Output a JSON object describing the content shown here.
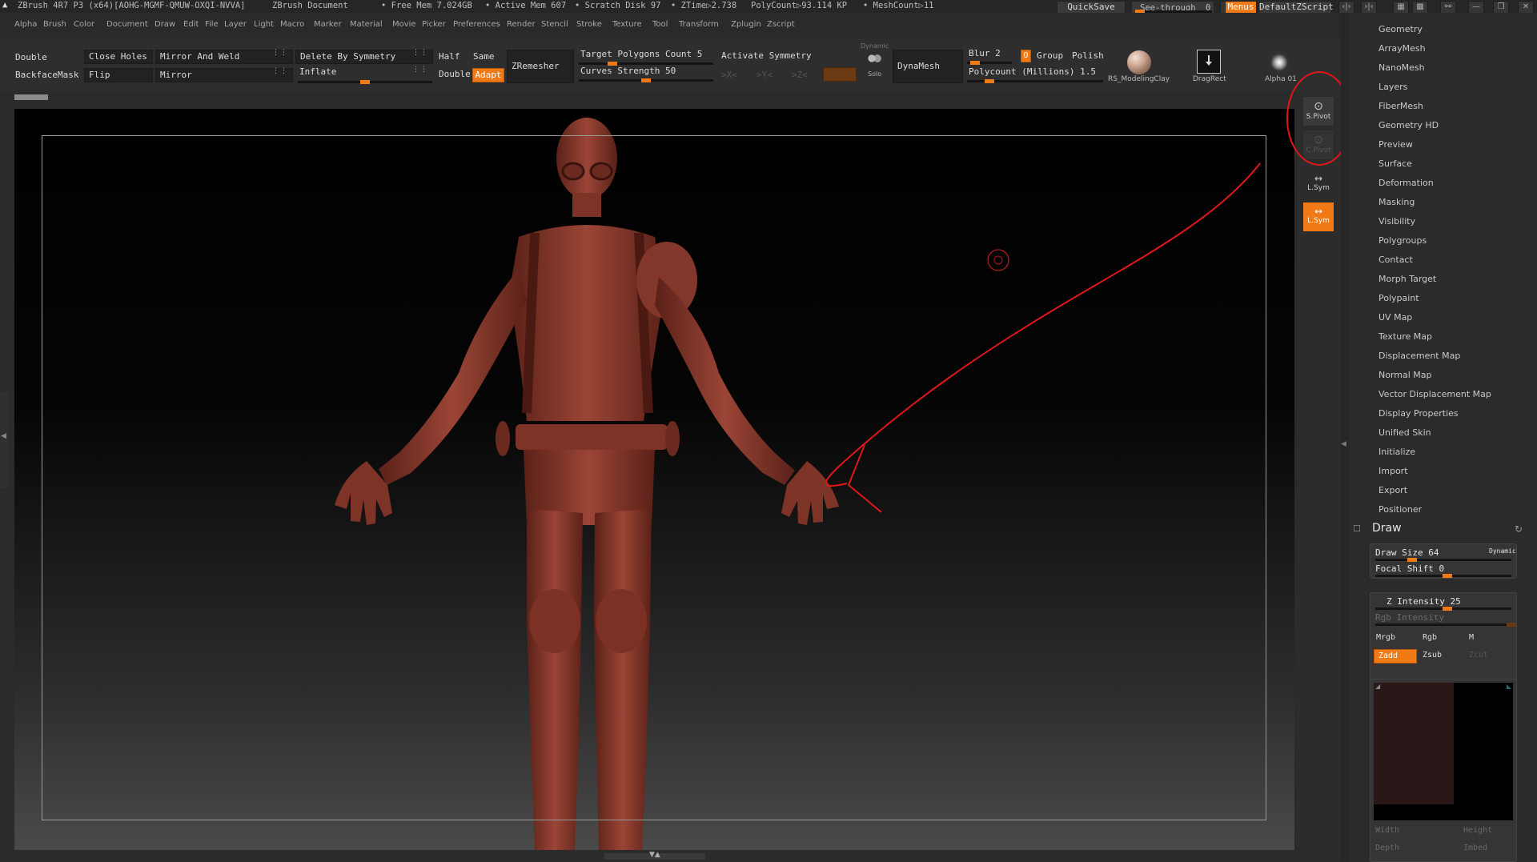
{
  "title_bar": {
    "app_title": "ZBrush 4R7 P3 (x64)[AOHG-MGMF-QMUW-OXQI-NVVA]",
    "document": "ZBrush Document",
    "free_mem": "• Free Mem 7.024GB",
    "active_mem": "• Active Mem 607",
    "scratch_disk": "• Scratch Disk 97",
    "ztime": "• ZTime▷2.738",
    "polycount": "PolyCount▷93.114 KP",
    "meshcount": "• MeshCount▷11",
    "quicksave": "QuickSave",
    "see_through_label": "See-through",
    "see_through_value": "0",
    "see_through_fraction": 0.0,
    "menus": "Menus",
    "default_zscript": "DefaultZScript"
  },
  "menu_bar": [
    "Alpha",
    "Brush",
    "Color",
    "Document",
    "Draw",
    "Edit",
    "File",
    "Layer",
    "Light",
    "Macro",
    "Marker",
    "Material",
    "Movie",
    "Picker",
    "Preferences",
    "Render",
    "Stencil",
    "Stroke",
    "Texture",
    "Tool",
    "Transform",
    "Zplugin",
    "Zscript"
  ],
  "shelf": {
    "double": "Double",
    "backface_mask": "BackfaceMask",
    "close_holes": "Close Holes",
    "flip": "Flip",
    "mirror_and_weld": "Mirror And Weld",
    "mirror": "Mirror",
    "delete_by_symmetry": "Delete By Symmetry",
    "inflate": "Inflate",
    "half": "Half",
    "same": "Same",
    "double2": "Double",
    "adapt": "Adapt",
    "zremesher": "ZRemesher",
    "target_polygons_count": "Target Polygons Count 5",
    "curves_strength": "Curves Strength 50",
    "activate_symmetry": "Activate Symmetry",
    "sym_x": ">X<",
    "sym_y": ">Y<",
    "sym_z": ">Z<",
    "dynamic": "Dynamic",
    "solo": "Solo",
    "dynamesh": "DynaMesh",
    "blur": "Blur 2",
    "group_toggle": "O",
    "group": "Group",
    "polish": "Polish",
    "polycount_millions": "Polycount (Millions) 1.5",
    "material_name": "RS_ModelingClay",
    "stroke_name": "DragRect",
    "alpha_name": "Alpha 01"
  },
  "vertical_tools": {
    "spivot": "S.Pivot",
    "cpivot": "C.Pivot",
    "lsym": "L.Sym",
    "lsym_active": "L.Sym"
  },
  "palette": {
    "items": [
      "Geometry",
      "ArrayMesh",
      "NanoMesh",
      "Layers",
      "FiberMesh",
      "Geometry HD",
      "Preview",
      "Surface",
      "Deformation",
      "Masking",
      "Visibility",
      "Polygroups",
      "Contact",
      "Morph Target",
      "Polypaint",
      "UV Map",
      "Texture Map",
      "Displacement Map",
      "Normal Map",
      "Vector Displacement Map",
      "Display Properties",
      "Unified Skin",
      "Initialize",
      "Import",
      "Export",
      "Positioner"
    ],
    "draw_header": "Draw",
    "draw_size": "Draw Size 64",
    "dynamic": "Dynamic",
    "focal_shift": "Focal Shift 0",
    "z_intensity": "Z Intensity 25",
    "rgb_intensity": "Rgb Intensity",
    "mrgb": "Mrgb",
    "rgb": "Rgb",
    "m": "M",
    "zadd": "Zadd",
    "zsub": "Zsub",
    "zcut": "Zcut",
    "width": "Width",
    "height": "Height",
    "depth": "Depth",
    "imbed": "Imbed"
  },
  "colors": {
    "accent": "#f07a16",
    "annotation": "#e0161b",
    "model": "#8a3a2e"
  }
}
